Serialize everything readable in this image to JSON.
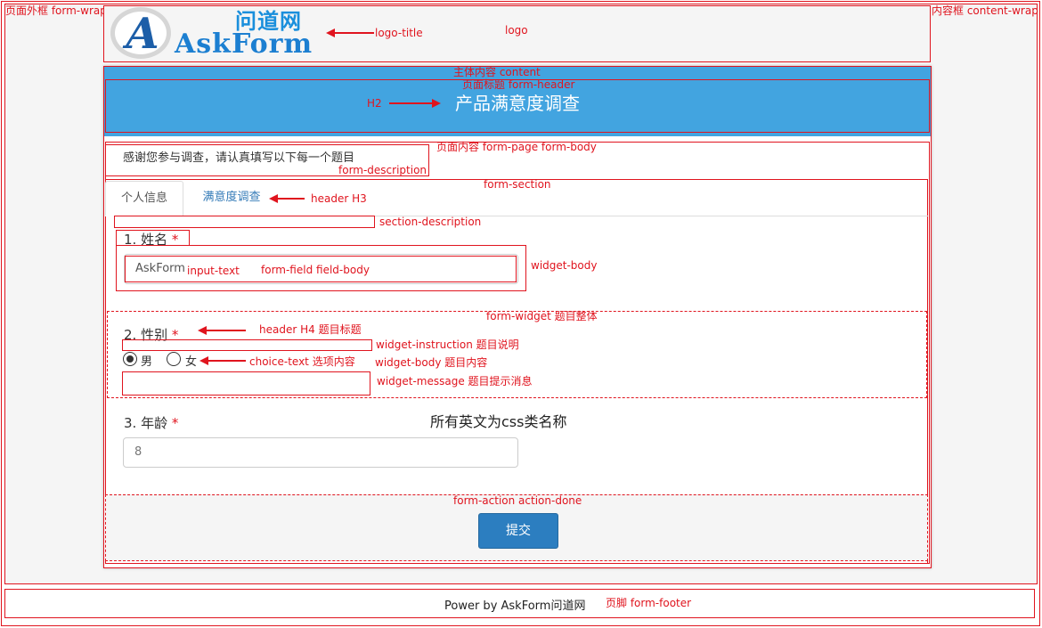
{
  "logo": {
    "icon_letter": "A",
    "title_cn": "问道网",
    "title_en": "AskForm"
  },
  "header": {
    "title": "产品满意度调查"
  },
  "form": {
    "description": "感谢您参与调查，请认真填写以下每一个题目",
    "tabs": [
      {
        "label": "个人信息"
      },
      {
        "label": "满意度调查"
      }
    ],
    "questions": [
      {
        "title": "1. 姓名",
        "required": "*",
        "value": "AskForm"
      },
      {
        "title": "2. 性别",
        "required": "*",
        "options": [
          {
            "label": "男",
            "checked": true
          },
          {
            "label": "女",
            "checked": false
          }
        ]
      },
      {
        "title": "3. 年龄",
        "required": "*",
        "value": "8"
      }
    ],
    "submit_label": "提交"
  },
  "center_note": "所有英文为css类名称",
  "footer": {
    "text": "Power by AskForm问道网"
  },
  "annotations": {
    "form_wrap": "页面外框 form-wrap",
    "content_wrap": "内容框 content-wrap",
    "logo_title": "logo-title",
    "logo": "logo",
    "content": "主体内容 content",
    "form_header": "页面标题 form-header",
    "h2": "H2",
    "form_body": "页面内容 form-page form-body",
    "form_description": "form-description",
    "form_section": "form-section",
    "header_h3": "header H3",
    "section_description": "section-description",
    "input_text": "input-text",
    "form_field": "form-field field-body",
    "widget_body_top": "widget-body",
    "form_widget": "form-widget  题目整体",
    "header_h4": "header H4  题目标题",
    "widget_instruction": "widget-instruction  题目说明",
    "choice_text": "choice-text 选项内容",
    "widget_body": "widget-body 题目内容",
    "widget_message": "widget-message 题目提示消息",
    "form_action": "form-action action-done",
    "form_footer": "页脚 form-footer"
  },
  "colors": {
    "accent": "#42a4e0",
    "annotation": "#e0141e",
    "button": "#2c7ec0"
  }
}
